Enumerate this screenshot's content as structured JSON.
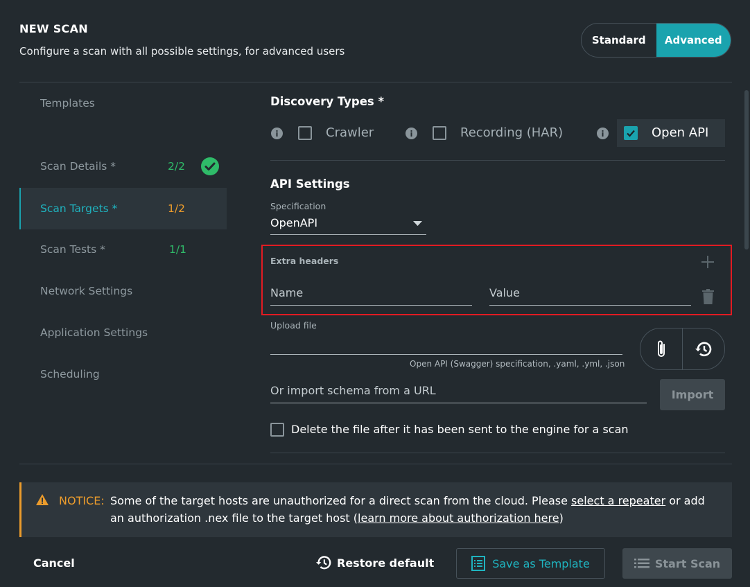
{
  "header": {
    "title": "NEW SCAN",
    "subtitle": "Configure a scan with all possible settings, for advanced users",
    "mode_standard": "Standard",
    "mode_advanced": "Advanced",
    "active_mode": "Advanced"
  },
  "sidebar": {
    "items": [
      {
        "label": "Templates",
        "count": "",
        "status": ""
      },
      {
        "label": "Scan Details *",
        "count": "2/2",
        "status": "complete"
      },
      {
        "label": "Scan Targets *",
        "count": "1/2",
        "status": "incomplete"
      },
      {
        "label": "Scan Tests *",
        "count": "1/1",
        "status": "complete"
      },
      {
        "label": "Network Settings",
        "count": "",
        "status": ""
      },
      {
        "label": "Application Settings",
        "count": "",
        "status": ""
      },
      {
        "label": "Scheduling",
        "count": "",
        "status": ""
      }
    ],
    "active_index": 2
  },
  "discovery": {
    "title": "Discovery Types *",
    "options": [
      {
        "label": "Crawler",
        "checked": false
      },
      {
        "label": "Recording (HAR)",
        "checked": false
      },
      {
        "label": "Open API",
        "checked": true
      }
    ]
  },
  "api_settings": {
    "title": "API Settings",
    "spec_label": "Specification",
    "spec_value": "OpenAPI",
    "extra_headers_label": "Extra headers",
    "name_placeholder": "Name",
    "value_placeholder": "Value",
    "upload_label": "Upload file",
    "upload_hint": "Open API (Swagger) specification, .yaml, .yml, .json",
    "url_placeholder": "Or import schema from a URL",
    "import_label": "Import",
    "delete_file_label": "Delete the file after it has been sent to the engine for a scan",
    "delete_file_checked": false
  },
  "notice": {
    "prefix": "NOTICE:",
    "text_1": "Some of the target hosts are unauthorized for a direct scan from the cloud. Please ",
    "link_1": "select a repeater",
    "text_2": " or add an authorization .nex file to the target host (",
    "link_2": "learn more about authorization here",
    "text_3": ")"
  },
  "footer": {
    "cancel": "Cancel",
    "restore": "Restore default",
    "save_template": "Save as Template",
    "start_scan": "Start Scan"
  },
  "colors": {
    "accent": "#1aa3ae",
    "success": "#2fbb69",
    "warning": "#ec9c2c",
    "highlight": "#e21b22"
  }
}
